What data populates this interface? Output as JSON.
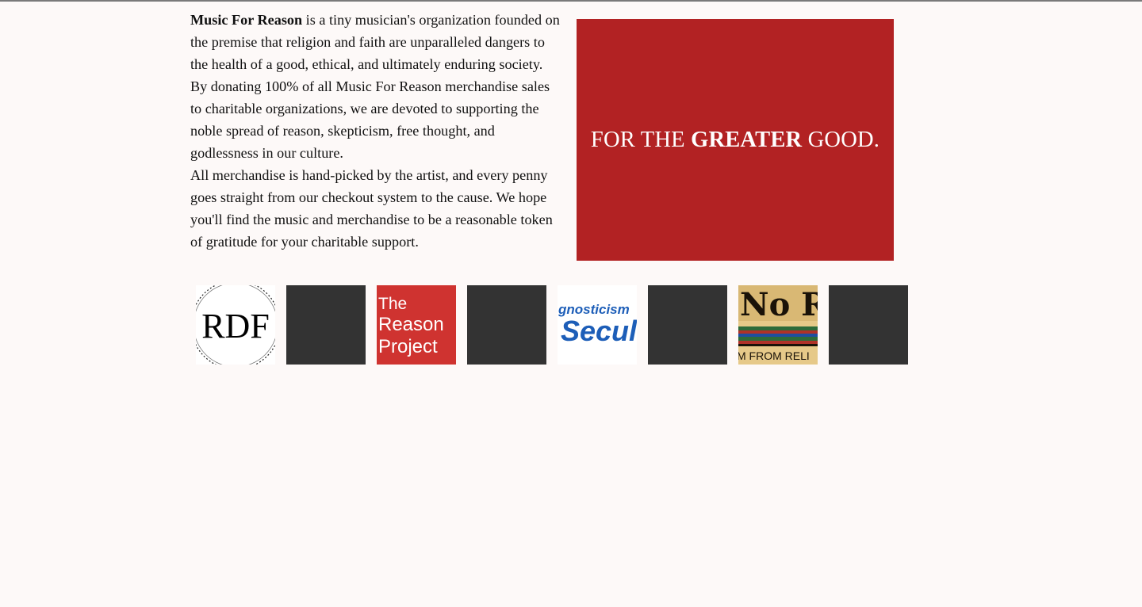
{
  "intro": {
    "org_name": "Music For Reason",
    "p1_rest": " is a tiny musician's organization founded on the premise that religion and faith are unparalleled dangers to the health of a good, ethical, and ultimately enduring society.",
    "p2": "By donating 100% of all Music For Reason merchandise sales to charitable organizations, we are devoted to supporting the noble spread of reason, skepticism, free thought, and godlessness in our culture.",
    "p3": "All merchandise is hand-picked by the artist, and every penny goes straight from our checkout system to the cause. We hope you'll find the music and merchandise to be a reasonable token of gratitude for your charitable support."
  },
  "banner": {
    "pre": "FOR THE ",
    "emphasis": "GREATER",
    "post": " GOOD.",
    "color": "#b22223"
  },
  "logos": [
    {
      "name": "rdf-logo",
      "text": "RDF"
    },
    {
      "name": "dark-tile-1"
    },
    {
      "name": "reason-project-logo",
      "lines": [
        "The",
        "Reason",
        "Project"
      ],
      "color": "#cf3330"
    },
    {
      "name": "dark-tile-2"
    },
    {
      "name": "secular-logo",
      "lines": [
        "gnosticism",
        "Secul"
      ],
      "color": "#1d5eb8"
    },
    {
      "name": "dark-tile-3"
    },
    {
      "name": "no-religion-logo",
      "lines": [
        "No R",
        "M FROM RELI"
      ]
    },
    {
      "name": "dark-tile-4"
    }
  ]
}
